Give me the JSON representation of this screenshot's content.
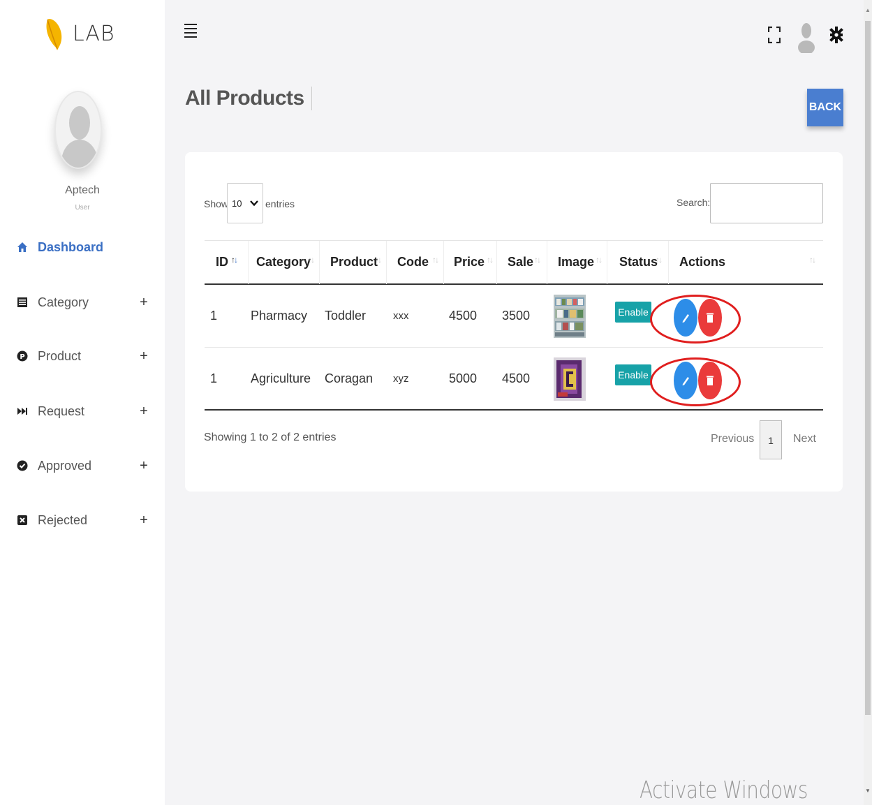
{
  "brand": {
    "name": "LAB",
    "logo_color": "#f5b400"
  },
  "user": {
    "name": "Aptech",
    "role": "User"
  },
  "sidebar": {
    "items": [
      {
        "label": "Dashboard",
        "icon": "home-icon",
        "active": true
      },
      {
        "label": "Category",
        "icon": "list-icon"
      },
      {
        "label": "Product",
        "icon": "product-p-icon"
      },
      {
        "label": "Request",
        "icon": "fast-forward-icon"
      },
      {
        "label": "Approved",
        "icon": "check-circle-icon"
      },
      {
        "label": "Rejected",
        "icon": "x-square-icon"
      }
    ],
    "plus": "+"
  },
  "topbar": {
    "icons": [
      "menu-icon",
      "fullscreen-icon",
      "user-icon",
      "gear-icon"
    ]
  },
  "page": {
    "title": "All Products",
    "back_label": "BACK"
  },
  "table_controls": {
    "show_label": "Show",
    "page_size": "10",
    "entries_label": "entries",
    "search_label": "Search:",
    "search_value": ""
  },
  "table": {
    "columns": [
      "ID",
      "Category",
      "Product",
      "Code",
      "Price",
      "Sale",
      "Image",
      "Status",
      "Actions"
    ],
    "rows": [
      {
        "id": "1",
        "category": "Pharmacy",
        "product": "Toddler",
        "code": "xxx",
        "price": "4500",
        "sale": "3500",
        "image": "pharmacy-shelf-image",
        "status": "Enable"
      },
      {
        "id": "1",
        "category": "Agriculture",
        "product": "Coragan",
        "code": "xyz",
        "price": "5000",
        "sale": "4500",
        "image": "coragan-product-image",
        "status": "Enable"
      }
    ]
  },
  "pagination": {
    "info": "Showing 1 to 2 of 2 entries",
    "previous": "Previous",
    "current_page": "1",
    "next": "Next"
  },
  "watermark": "Activate Windows",
  "colors": {
    "accent": "#3a6fc4",
    "back_button": "#4a7ed0",
    "status_enable": "#17a2a8",
    "edit": "#2d8de8",
    "delete": "#ea3b3b",
    "annotation": "#e01e1e"
  }
}
